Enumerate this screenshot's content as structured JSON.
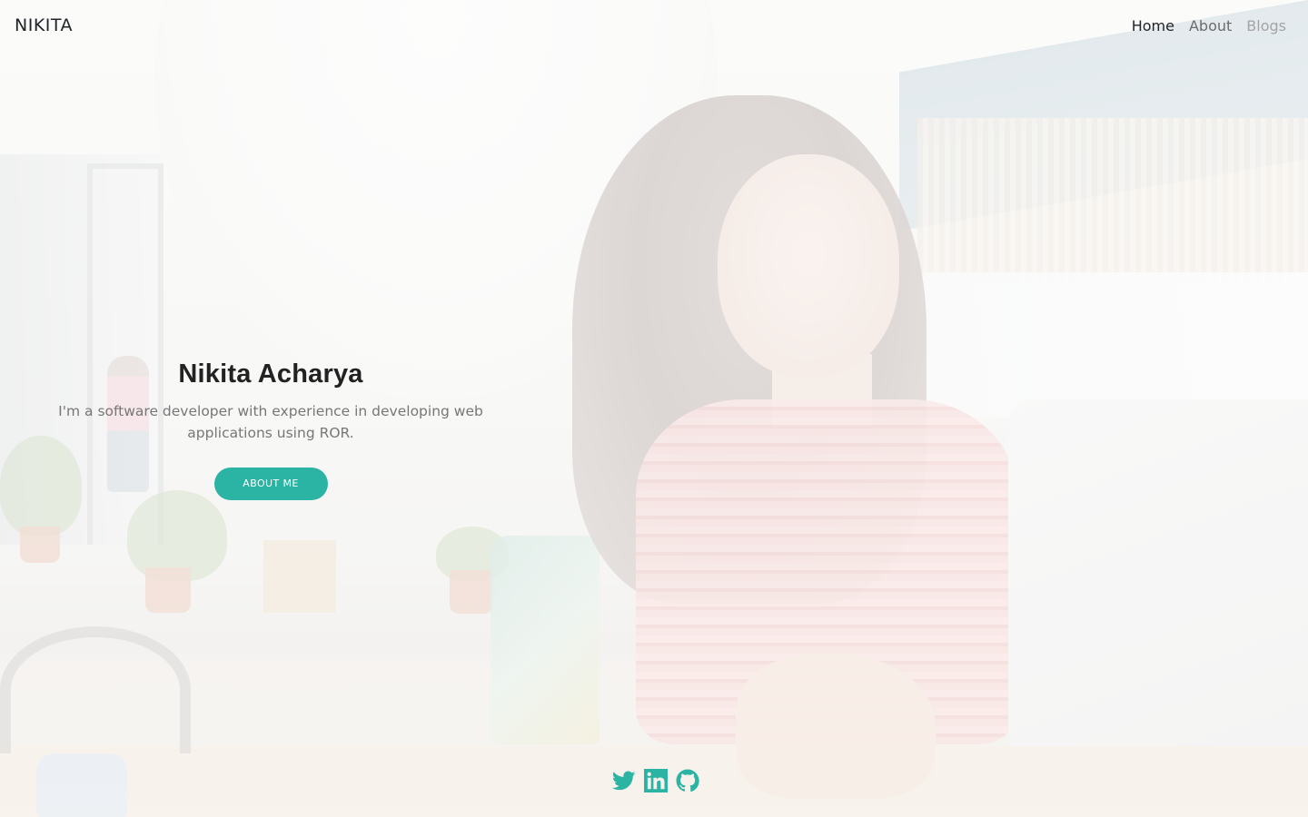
{
  "navbar": {
    "brand": "NIKITA",
    "links": [
      {
        "label": "Home",
        "state": "active"
      },
      {
        "label": "About",
        "state": "normal"
      },
      {
        "label": "Blogs",
        "state": "faded"
      }
    ]
  },
  "hero": {
    "title": "Nikita Acharya",
    "description": "I'm a software developer with experience in developing web applications using ROR.",
    "button_label": "ABOUT ME"
  },
  "social": {
    "icons": [
      "twitter-icon",
      "linkedin-icon",
      "github-icon"
    ],
    "color": "#2bb3a3"
  },
  "colors": {
    "accent": "#2bb3a3",
    "title": "#222222",
    "body_text": "#777777"
  }
}
